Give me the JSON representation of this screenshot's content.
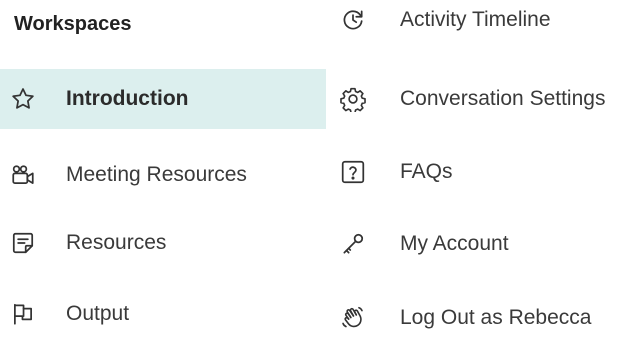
{
  "colors": {
    "active_bg": "#dcefee",
    "text": "#3a3a3a",
    "icon": "#333333"
  },
  "left_column": {
    "heading": "Workspaces",
    "items": [
      {
        "label": "Introduction",
        "icon": "star-icon",
        "active": true
      },
      {
        "label": "Meeting Resources",
        "icon": "meeting-camera-icon",
        "active": false
      },
      {
        "label": "Resources",
        "icon": "note-icon",
        "active": false
      },
      {
        "label": "Output",
        "icon": "flag-icon",
        "active": false
      }
    ]
  },
  "right_column": {
    "items": [
      {
        "label": "Activity Timeline",
        "icon": "clock-refresh-icon"
      },
      {
        "label": "Conversation Settings",
        "icon": "gear-icon"
      },
      {
        "label": "FAQs",
        "icon": "question-icon"
      },
      {
        "label": "My Account",
        "icon": "key-icon"
      },
      {
        "label": "Log Out as Rebecca",
        "icon": "waving-hand-icon"
      }
    ]
  }
}
